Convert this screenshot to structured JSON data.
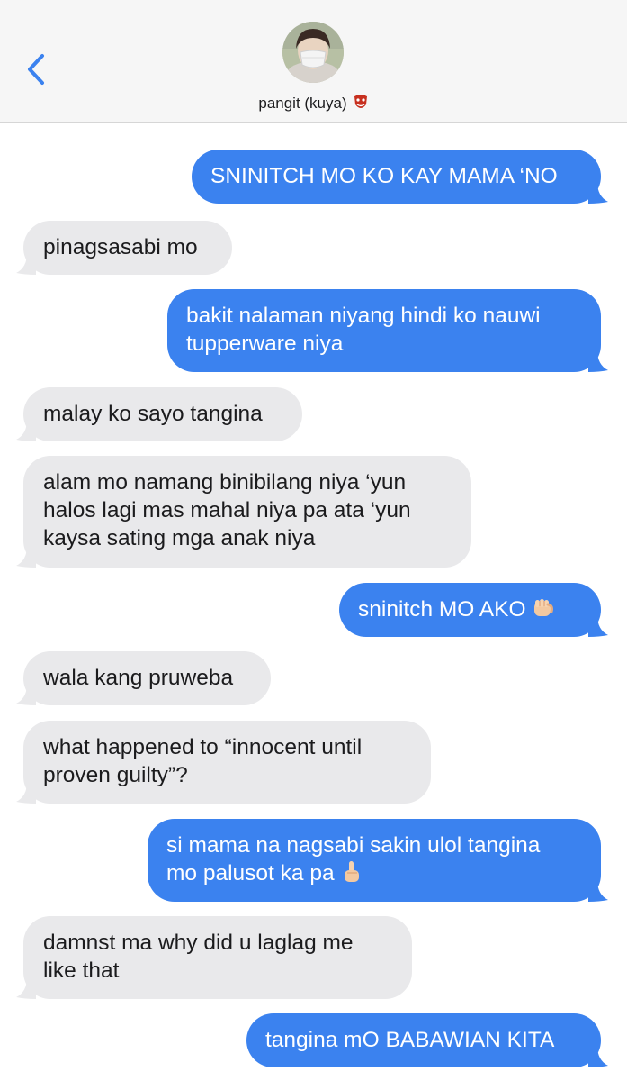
{
  "header": {
    "contact_name": "pangit (kuya)",
    "name_emoji": "goblin-emoji",
    "back_icon": "chevron-left-icon",
    "accent_color": "#3b82ef"
  },
  "messages": [
    {
      "direction": "sent",
      "lines": [
        "SNINITCH MO KO KAY MAMA ‘NO"
      ]
    },
    {
      "direction": "received",
      "lines": [
        "pinagsasabi mo"
      ]
    },
    {
      "direction": "sent",
      "lines": [
        "bakit nalaman niyang hindi ko nauwi",
        "tupperware niya"
      ]
    },
    {
      "direction": "received",
      "lines": [
        "malay ko sayo tangina"
      ]
    },
    {
      "direction": "received",
      "lines": [
        "alam mo namang binibilang niya ‘yun",
        "halos lagi mas mahal niya pa ata ‘yun",
        "kaysa sating mga anak niya"
      ]
    },
    {
      "direction": "sent",
      "lines": [
        "sninitch MO AKO"
      ],
      "emoji": "fist-emoji"
    },
    {
      "direction": "received",
      "lines": [
        "wala kang pruweba"
      ]
    },
    {
      "direction": "received",
      "lines": [
        "what happened to “innocent until",
        "proven guilty”?"
      ]
    },
    {
      "direction": "sent",
      "lines": [
        "si mama na nagsabi sakin ulol tangina",
        "mo palusot ka pa"
      ],
      "emoji": "middle-finger-emoji"
    },
    {
      "direction": "received",
      "lines": [
        "damnst ma why did u laglag me",
        "like that"
      ]
    },
    {
      "direction": "sent",
      "lines": [
        "tangina mO BABAWIAN KITA"
      ]
    }
  ]
}
